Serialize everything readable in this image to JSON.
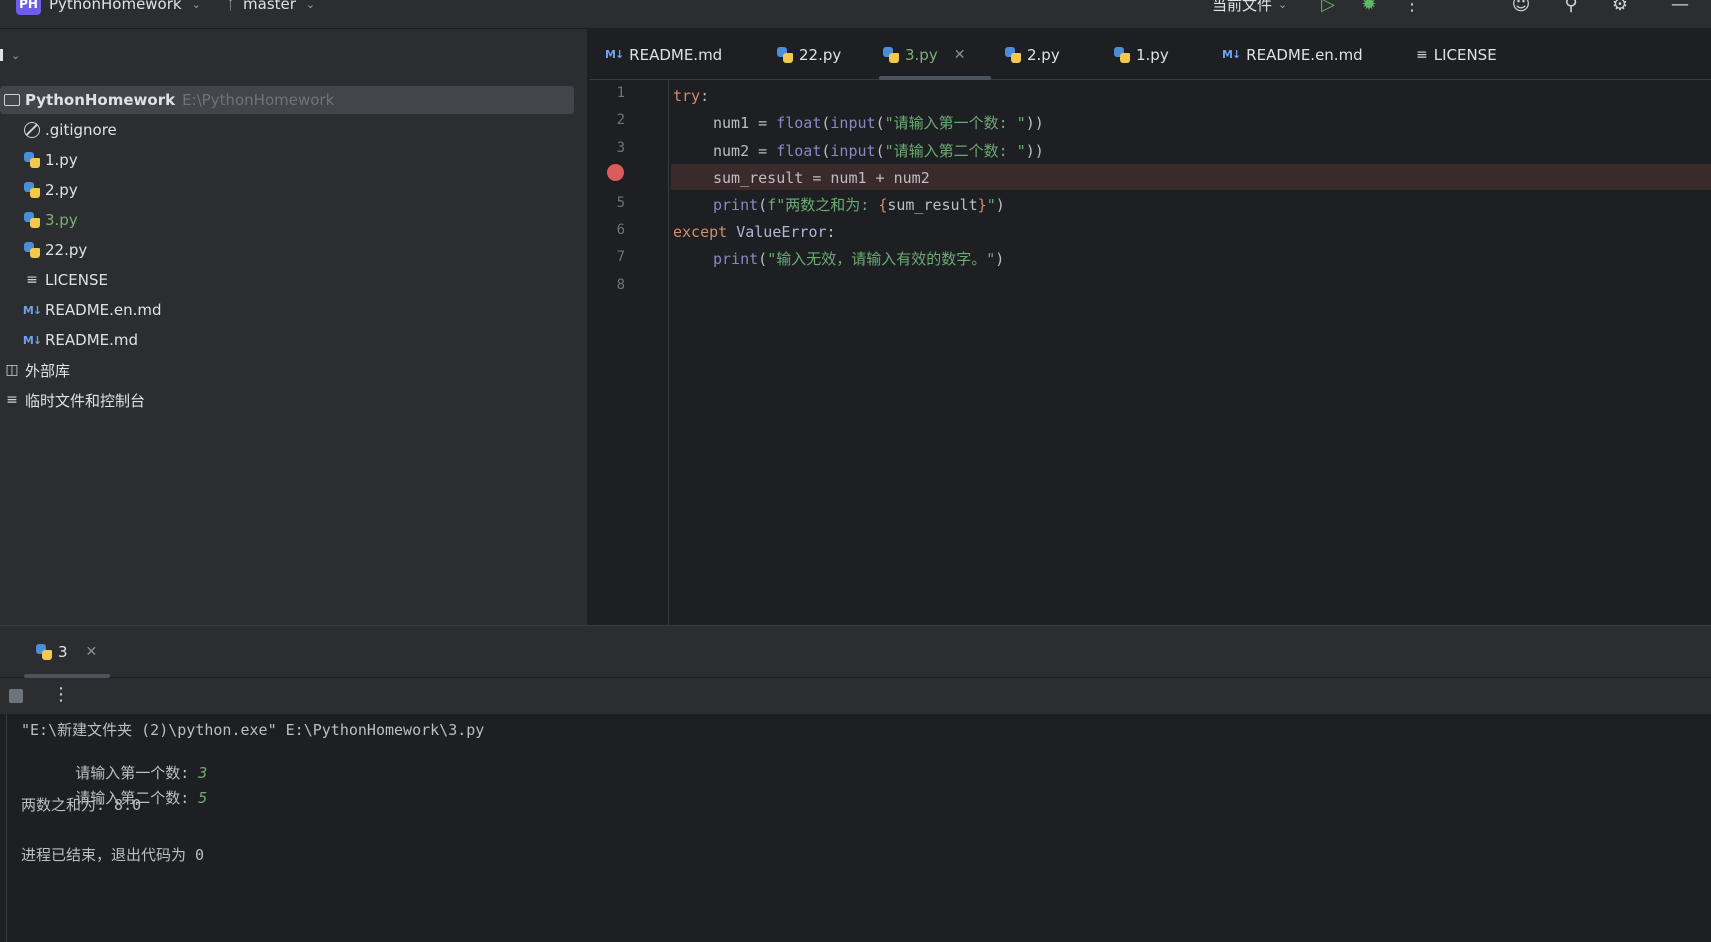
{
  "titlebar": {
    "project_badge": "PH",
    "project_name": "PythonHomework",
    "branch": "master",
    "run_config": "当前文件"
  },
  "project_panel": {
    "root_name": "PythonHomework",
    "root_path": "E:\\PythonHomework",
    "items": [
      {
        "label": ".gitignore",
        "icon": "gitignore-icon"
      },
      {
        "label": "1.py",
        "icon": "python-file-icon"
      },
      {
        "label": "2.py",
        "icon": "python-file-icon"
      },
      {
        "label": "3.py",
        "icon": "python-file-icon"
      },
      {
        "label": "22.py",
        "icon": "python-file-icon"
      },
      {
        "label": "LICENSE",
        "icon": "text-file-icon"
      },
      {
        "label": "README.en.md",
        "icon": "markdown-file-icon"
      },
      {
        "label": "README.md",
        "icon": "markdown-file-icon"
      }
    ],
    "external_libs": "外部库",
    "scratches": "临时文件和控制台"
  },
  "editor": {
    "tabs": [
      {
        "label": "README.md",
        "icon": "markdown-file-icon"
      },
      {
        "label": "22.py",
        "icon": "python-file-icon"
      },
      {
        "label": "3.py",
        "icon": "python-file-icon",
        "active": true
      },
      {
        "label": "2.py",
        "icon": "python-file-icon"
      },
      {
        "label": "1.py",
        "icon": "python-file-icon"
      },
      {
        "label": "README.en.md",
        "icon": "markdown-file-icon"
      },
      {
        "label": "LICENSE",
        "icon": "text-file-icon"
      }
    ],
    "line_numbers": [
      "1",
      "2",
      "3",
      "4",
      "5",
      "6",
      "7",
      "8"
    ],
    "breakpoint_line": 4,
    "code": {
      "l1_kw": "try",
      "l1_colon": ":",
      "l2_var": "num1 = ",
      "l2_float": "float",
      "l2_p1": "(",
      "l2_input": "input",
      "l2_p2": "(",
      "l2_str": "\"请输入第一个数: \"",
      "l2_p3": "))",
      "l3_var": "num2 = ",
      "l3_float": "float",
      "l3_p1": "(",
      "l3_input": "input",
      "l3_p2": "(",
      "l3_str": "\"请输入第二个数: \"",
      "l3_p3": "))",
      "l4": "sum_result = num1 + num2",
      "l5_print": "print",
      "l5_p1": "(",
      "l5_f": "f\"两数之和为: ",
      "l5_br1": "{",
      "l5_expr": "sum_result",
      "l5_br2": "}",
      "l5_q": "\"",
      "l5_p2": ")",
      "l6_kw": "except ",
      "l6_cls": "ValueError",
      "l6_colon": ":",
      "l7_print": "print",
      "l7_p1": "(",
      "l7_str": "\"输入无效，请输入有效的数字。\"",
      "l7_p2": ")"
    }
  },
  "run_panel": {
    "tab_label": "3",
    "console": {
      "cmd": "\"E:\\新建文件夹 (2)\\python.exe\" E:\\PythonHomework\\3.py",
      "prompt1": "请输入第一个数: ",
      "input1": "3",
      "prompt2": "请输入第二个数: ",
      "input2": "5",
      "result": "两数之和为: 8.0",
      "exit": "进程已结束，退出代码为 0"
    }
  },
  "colors": {
    "background": "#1e1f22",
    "panel": "#2b2d30",
    "keyword": "#cf8e6d",
    "string": "#6aab73",
    "function": "#56a8f5",
    "breakpoint": "#db5c5c"
  }
}
